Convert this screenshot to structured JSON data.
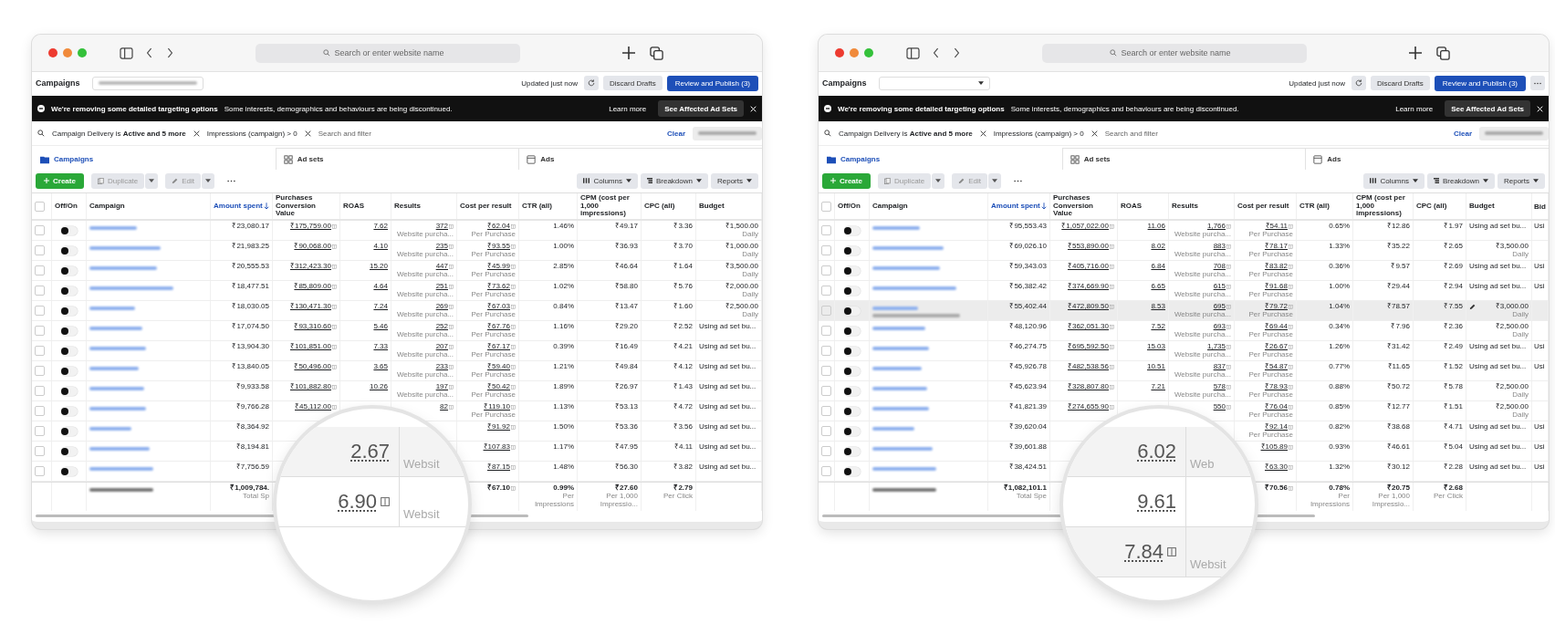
{
  "windows": [
    {
      "address_placeholder": "Search or enter website name",
      "header": {
        "title": "Campaigns",
        "account": {
          "kind": "blurred"
        },
        "status": "Updated just now",
        "discard": "Discard Drafts",
        "publish": "Review and Publish (3)"
      },
      "banner": {
        "title": "We're removing some detailed targeting options",
        "text": "Some interests, demographics and behaviours are being discontinued.",
        "link": "Learn more",
        "button": "See Affected Ad Sets"
      },
      "filters": {
        "chips": [
          "Campaign Delivery is **Active and 5 more**",
          "Impressions (campaign) > 0"
        ],
        "placeholder": "Search and filter",
        "clear": "Clear"
      },
      "tabs": [
        {
          "label": "Campaigns",
          "selected": true
        },
        {
          "label": "Ad sets",
          "selected": false
        },
        {
          "label": "Ads",
          "selected": false
        }
      ],
      "toolbar": {
        "create": "Create",
        "duplicate": {
          "label": "Duplicate",
          "disabled": true
        },
        "edit": {
          "label": "Edit",
          "disabled": true
        },
        "columns": "Columns",
        "breakdown": "Breakdown",
        "reports": "Reports"
      },
      "table": {
        "columns": [
          {
            "label": "Off/On",
            "kind": "toggle",
            "sorted": false
          },
          {
            "label": "Campaign",
            "kind": "name",
            "sorted": false
          },
          {
            "label": "Amount spent",
            "kind": "money",
            "sorted": true
          },
          {
            "label": "Purchases Conversion Value",
            "kind": "link_icon",
            "sorted": false
          },
          {
            "label": "ROAS",
            "kind": "link",
            "sorted": false
          },
          {
            "label": "Results",
            "kind": "link_icon",
            "sorted": false
          },
          {
            "label": "Cost per result",
            "kind": "link_icon",
            "sorted": false
          },
          {
            "label": "CTR (all)",
            "kind": "plain",
            "sorted": false
          },
          {
            "label": "CPM (cost per 1,000 impressions)",
            "kind": "plain",
            "sorted": false
          },
          {
            "label": "CPC (all)",
            "kind": "plain",
            "sorted": false
          },
          {
            "label": "Budget",
            "kind": "budget",
            "sorted": false
          }
        ],
        "rows": [
          {
            "on": false,
            "selected": false,
            "cells": [
              "",
              "",
              "₹23,080.17",
              "₹175,759.00",
              "7.62",
              {
                "value": "372",
                "sub": "Website purcha..."
              },
              {
                "value": "₹62.04",
                "sub": "Per Purchase"
              },
              "1.46%",
              "₹49.17",
              "₹3.36",
              {
                "value": "₹1,500.00",
                "sub": "Daily"
              }
            ]
          },
          {
            "on": false,
            "selected": false,
            "cells": [
              "",
              "",
              "₹21,983.25",
              "₹90,068.00",
              "4.10",
              {
                "value": "235",
                "sub": "Website purcha..."
              },
              {
                "value": "₹93.55",
                "sub": "Per Purchase"
              },
              "1.00%",
              "₹36.93",
              "₹3.70",
              {
                "value": "₹1,000.00",
                "sub": "Daily"
              }
            ]
          },
          {
            "on": false,
            "selected": false,
            "cells": [
              "",
              "",
              "₹20,555.53",
              "₹312,423.30",
              "15.20",
              {
                "value": "447",
                "sub": "Website purcha..."
              },
              {
                "value": "₹45.99",
                "sub": "Per Purchase"
              },
              "2.85%",
              "₹46.64",
              "₹1.64",
              {
                "value": "₹3,500.00",
                "sub": "Daily"
              }
            ]
          },
          {
            "on": false,
            "selected": false,
            "cells": [
              "",
              "",
              "₹18,477.51",
              "₹85,809.00",
              "4.64",
              {
                "value": "251",
                "sub": "Website purcha..."
              },
              {
                "value": "₹73.62",
                "sub": "Per Purchase"
              },
              "1.02%",
              "₹58.80",
              "₹5.76",
              {
                "value": "₹2,000.00",
                "sub": "Daily"
              }
            ]
          },
          {
            "on": false,
            "selected": false,
            "cells": [
              "",
              "",
              "₹18,030.05",
              "₹130,471.30",
              "7.24",
              {
                "value": "269",
                "sub": "Website purcha..."
              },
              {
                "value": "₹67.03",
                "sub": "Per Purchase"
              },
              "0.84%",
              "₹13.47",
              "₹1.60",
              {
                "value": "₹2,500.00",
                "sub": "Daily"
              }
            ]
          },
          {
            "on": false,
            "selected": false,
            "cells": [
              "",
              "",
              "₹17,074.50",
              "₹93,310.60",
              "5.46",
              {
                "value": "252",
                "sub": "Website purcha..."
              },
              {
                "value": "₹67.76",
                "sub": "Per Purchase"
              },
              "1.16%",
              "₹29.20",
              "₹2.52",
              "Using ad set bu..."
            ]
          },
          {
            "on": false,
            "selected": false,
            "cells": [
              "",
              "",
              "₹13,904.30",
              "₹101,851.00",
              "7.33",
              {
                "value": "207",
                "sub": "Website purcha..."
              },
              {
                "value": "₹67.17",
                "sub": "Per Purchase"
              },
              "0.39%",
              "₹16.49",
              "₹4.21",
              "Using ad set bu..."
            ]
          },
          {
            "on": false,
            "selected": false,
            "cells": [
              "",
              "",
              "₹13,840.05",
              "₹50,496.00",
              "3.65",
              {
                "value": "233",
                "sub": "Website purcha..."
              },
              {
                "value": "₹59.40",
                "sub": "Per Purchase"
              },
              "1.21%",
              "₹49.84",
              "₹4.12",
              "Using ad set bu..."
            ]
          },
          {
            "on": false,
            "selected": false,
            "cells": [
              "",
              "",
              "₹9,933.58",
              "₹101,882.80",
              "10.26",
              {
                "value": "197",
                "sub": "Website purcha..."
              },
              {
                "value": "₹50.42",
                "sub": "Per Purchase"
              },
              "1.89%",
              "₹26.97",
              "₹1.43",
              "Using ad set bu..."
            ]
          },
          {
            "on": false,
            "selected": false,
            "cells": [
              "",
              "",
              "₹9,766.28",
              "₹45,112.00",
              "",
              "82",
              {
                "value": "₹119.10",
                "sub": "Per Purchase"
              },
              "1.13%",
              "₹53.13",
              "₹4.72",
              "Using ad set bu..."
            ]
          },
          {
            "on": false,
            "selected": false,
            "cells": [
              "",
              "",
              "₹8,364.92",
              "",
              "",
              "",
              "₹91.92",
              "1.50%",
              "₹53.36",
              "₹3.56",
              "Using ad set bu..."
            ]
          },
          {
            "on": false,
            "selected": false,
            "cells": [
              "",
              "",
              "₹8,194.81",
              "",
              "",
              "",
              "₹107.83",
              "1.17%",
              "₹47.95",
              "₹4.11",
              "Using ad set bu..."
            ]
          },
          {
            "on": false,
            "selected": false,
            "cells": [
              "",
              "",
              "₹7,756.59",
              "",
              "",
              "",
              "₹87.15",
              "1.48%",
              "₹56.30",
              "₹3.82",
              "Using ad set bu..."
            ]
          }
        ],
        "total": {
          "amount_spent": {
            "value": "₹1,009,784.",
            "sub": "Total Sp"
          },
          "cost_per_result": "₹67.10",
          "ctr": {
            "value": "0.99%",
            "sub": "Per Impressions"
          },
          "cpm": {
            "value": "₹27.60",
            "sub": "Per 1,000 Impressio..."
          },
          "cpc": {
            "value": "₹2.79",
            "sub": "Per Click"
          }
        },
        "all_selected": false
      },
      "magnifier": [
        {
          "value": "2.67",
          "label": "Websit"
        },
        {
          "value": "6.90",
          "icon": true,
          "label": "Websit"
        }
      ]
    },
    {
      "address_placeholder": "Search or enter website name",
      "header": {
        "title": "Campaigns",
        "account": {
          "kind": "dropdown"
        },
        "status": "Updated just now",
        "discard": "Discard Drafts",
        "publish": "Review and Publish (3)",
        "more": true
      },
      "banner": {
        "title": "We're removing some detailed targeting options",
        "text": "Some interests, demographics and behaviours are being discontinued.",
        "link": "Learn more",
        "button": "See Affected Ad Sets"
      },
      "filters": {
        "chips": [
          "Campaign Delivery is **Active and 5 more**",
          "Impressions (campaign) > 0"
        ],
        "placeholder": "Search and filter",
        "clear": "Clear"
      },
      "tabs": [
        {
          "label": "Campaigns",
          "selected": true
        },
        {
          "label": "Ad sets",
          "selected": false
        },
        {
          "label": "Ads",
          "selected": false
        }
      ],
      "toolbar": {
        "create": "Create",
        "duplicate": {
          "label": "Duplicate",
          "disabled": true
        },
        "edit": {
          "label": "Edit",
          "disabled": true
        },
        "columns": "Columns",
        "breakdown": "Breakdown",
        "reports": "Reports"
      },
      "table": {
        "columns": [
          {
            "label": "Off/On",
            "kind": "toggle",
            "sorted": false
          },
          {
            "label": "Campaign",
            "kind": "name",
            "sorted": false
          },
          {
            "label": "Amount spent",
            "kind": "money",
            "sorted": true
          },
          {
            "label": "Purchases Conversion Value",
            "kind": "link_icon",
            "sorted": false
          },
          {
            "label": "ROAS",
            "kind": "link",
            "sorted": false
          },
          {
            "label": "Results",
            "kind": "link_icon",
            "sorted": false
          },
          {
            "label": "Cost per result",
            "kind": "link_icon",
            "sorted": false
          },
          {
            "label": "CTR (all)",
            "kind": "plain",
            "sorted": false
          },
          {
            "label": "CPM (cost per 1,000 impressions)",
            "kind": "plain",
            "sorted": false
          },
          {
            "label": "CPC (all)",
            "kind": "plain",
            "sorted": false
          },
          {
            "label": "Budget",
            "kind": "budget",
            "sorted": false
          },
          {
            "label": "Bid",
            "kind": "clip",
            "sorted": false
          }
        ],
        "rows": [
          {
            "on": false,
            "selected": false,
            "cells": [
              "",
              "",
              "₹95,553.43",
              "₹1,057,022.00",
              "11.06",
              {
                "value": "1,766",
                "sub": "Website purcha..."
              },
              {
                "value": "₹54.11",
                "sub": "Per Purchase"
              },
              "0.65%",
              "₹12.86",
              "₹1.97",
              "Using ad set bu...",
              "Usi"
            ]
          },
          {
            "on": false,
            "selected": false,
            "cells": [
              "",
              "",
              "₹69,026.10",
              "₹553,890.00",
              "8.02",
              {
                "value": "883",
                "sub": "Website purcha..."
              },
              {
                "value": "₹78.17",
                "sub": "Per Purchase"
              },
              "1.33%",
              "₹35.22",
              "₹2.65",
              {
                "value": "₹3,500.00",
                "sub": "Daily"
              },
              ""
            ]
          },
          {
            "on": false,
            "selected": false,
            "cells": [
              "",
              "",
              "₹59,343.03",
              "₹405,716.00",
              "6.84",
              {
                "value": "708",
                "sub": "Website purcha..."
              },
              {
                "value": "₹83.82",
                "sub": "Per Purchase"
              },
              "0.36%",
              "₹9.57",
              "₹2.69",
              "Using ad set bu...",
              "Usi"
            ]
          },
          {
            "on": false,
            "selected": false,
            "cells": [
              "",
              "",
              "₹56,382.42",
              "₹374,669.90",
              "6.65",
              {
                "value": "615",
                "sub": "Website purcha..."
              },
              {
                "value": "₹91.68",
                "sub": "Per Purchase"
              },
              "1.00%",
              "₹29.44",
              "₹2.94",
              "Using ad set bu...",
              "Usi"
            ]
          },
          {
            "on": false,
            "selected": true,
            "cells": [
              "",
              "",
              "₹55,402.44",
              "₹472,809.50",
              "8.53",
              {
                "value": "695",
                "sub": "Website purcha..."
              },
              {
                "value": "₹79.72",
                "sub": "Per Purchase"
              },
              "1.04%",
              "₹78.57",
              "₹7.55",
              {
                "value": "₹3,000.00",
                "sub": "Daily",
                "editing": true
              },
              ""
            ]
          },
          {
            "on": false,
            "selected": false,
            "cells": [
              "",
              "",
              "₹48,120.96",
              "₹362,051.30",
              "7.52",
              {
                "value": "693",
                "sub": "Website purcha..."
              },
              {
                "value": "₹69.44",
                "sub": "Per Purchase"
              },
              "0.34%",
              "₹7.96",
              "₹2.36",
              {
                "value": "₹2,500.00",
                "sub": "Daily"
              },
              ""
            ]
          },
          {
            "on": false,
            "selected": false,
            "cells": [
              "",
              "",
              "₹46,274.75",
              "₹695,592.50",
              "15.03",
              {
                "value": "1,735",
                "sub": "Website purcha..."
              },
              {
                "value": "₹26.67",
                "sub": "Per Purchase"
              },
              "1.26%",
              "₹31.42",
              "₹2.49",
              "Using ad set bu...",
              "Usi"
            ]
          },
          {
            "on": false,
            "selected": false,
            "cells": [
              "",
              "",
              "₹45,926.78",
              "₹482,538.56",
              "10.51",
              {
                "value": "837",
                "sub": "Website purcha..."
              },
              {
                "value": "₹54.87",
                "sub": "Per Purchase"
              },
              "0.77%",
              "₹11.65",
              "₹1.52",
              "Using ad set bu...",
              "Usi"
            ]
          },
          {
            "on": false,
            "selected": false,
            "cells": [
              "",
              "",
              "₹45,623.94",
              "₹328,807.80",
              "7.21",
              {
                "value": "578",
                "sub": "Website purcha..."
              },
              {
                "value": "₹78.93",
                "sub": "Per Purchase"
              },
              "0.88%",
              "₹50.72",
              "₹5.78",
              {
                "value": "₹2,500.00",
                "sub": "Daily"
              },
              ""
            ]
          },
          {
            "on": false,
            "selected": false,
            "cells": [
              "",
              "",
              "₹41,821.39",
              "₹274,655.90",
              "",
              "550",
              {
                "value": "₹76.04",
                "sub": "Per Purchase"
              },
              "0.85%",
              "₹12.77",
              "₹1.51",
              {
                "value": "₹2,500.00",
                "sub": "Daily"
              },
              ""
            ]
          },
          {
            "on": false,
            "selected": false,
            "cells": [
              "",
              "",
              "₹39,620.04",
              "",
              "",
              "",
              {
                "value": "₹92.14",
                "sub": "Per Purchase"
              },
              "0.82%",
              "₹38.68",
              "₹4.71",
              "Using ad set bu...",
              "Usi"
            ]
          },
          {
            "on": false,
            "selected": false,
            "cells": [
              "",
              "",
              "₹39,601.88",
              "",
              "",
              "",
              "₹105.89",
              "0.93%",
              "₹46.61",
              "₹5.04",
              "Using ad set bu...",
              "Usi"
            ]
          },
          {
            "on": false,
            "selected": false,
            "cells": [
              "",
              "",
              "₹38,424.51",
              "",
              "",
              "",
              "₹63.30",
              "1.32%",
              "₹30.12",
              "₹2.28",
              "Using ad set bu...",
              "Usi"
            ]
          }
        ],
        "total": {
          "amount_spent": {
            "value": "₹1,082,101.1",
            "sub": "Total Spe"
          },
          "cost_per_result": "₹70.56",
          "ctr": {
            "value": "0.78%",
            "sub": "Per Impressions"
          },
          "cpm": {
            "value": "₹20.75",
            "sub": "Per 1,000 Impressio..."
          },
          "cpc": {
            "value": "₹2.68",
            "sub": "Per Click"
          }
        },
        "all_selected": false
      },
      "magnifier": [
        {
          "value": "6.02",
          "label": "Web"
        },
        {
          "value": "9.61"
        },
        {
          "value": "7.84",
          "icon": true,
          "label": "Websit"
        }
      ]
    }
  ]
}
